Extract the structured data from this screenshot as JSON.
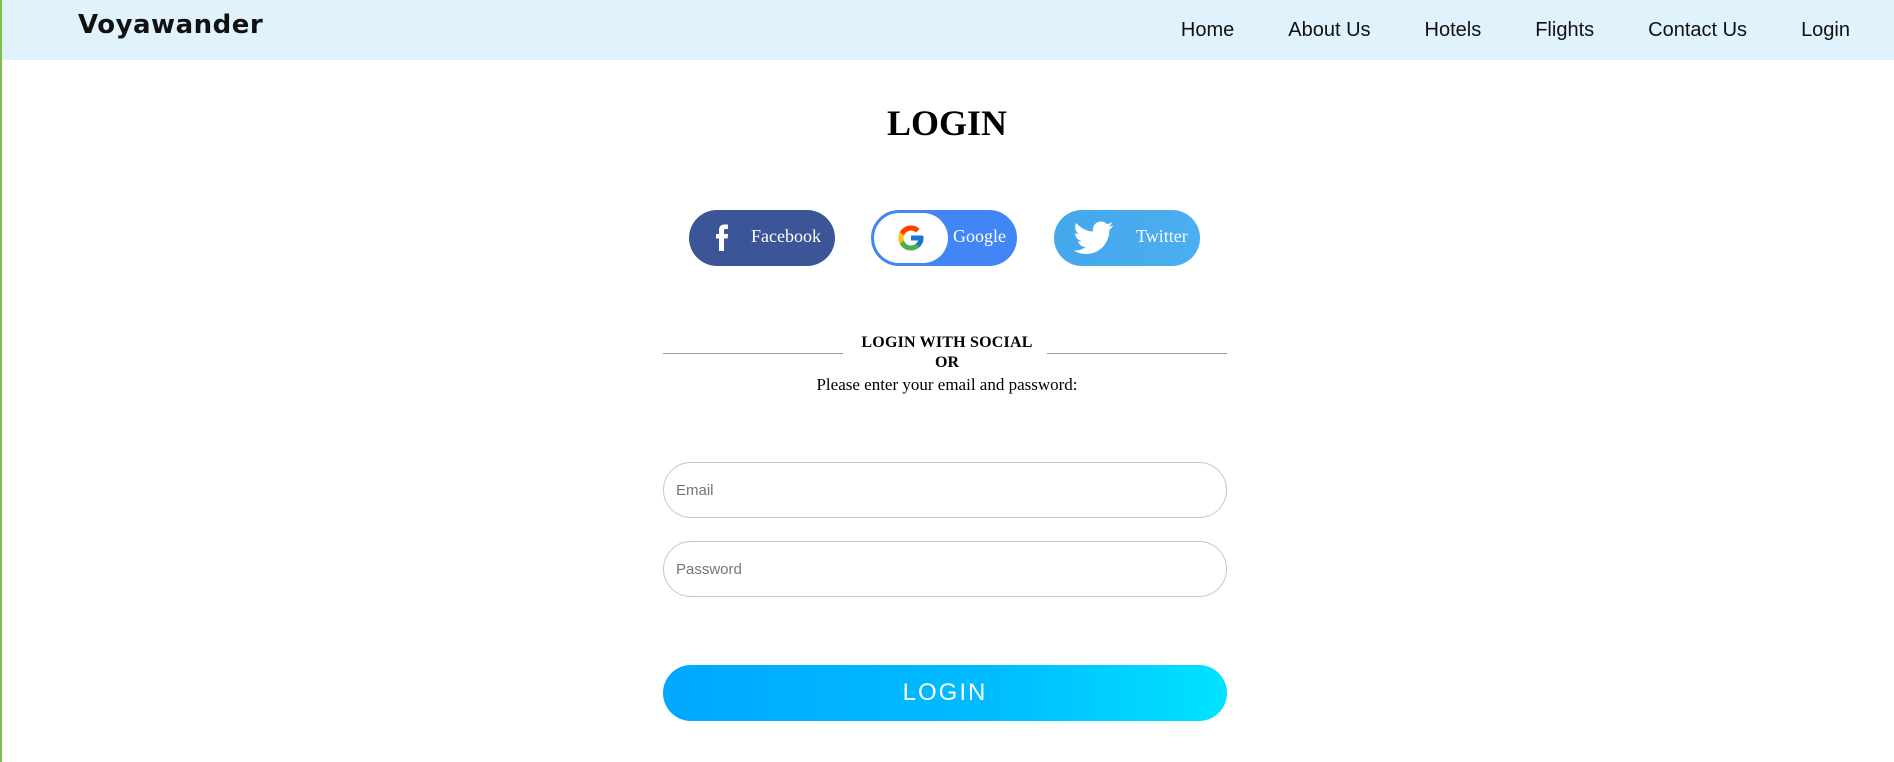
{
  "navbar": {
    "brand": "Voyawander",
    "links": [
      "Home",
      "About Us",
      "Hotels",
      "Flights",
      "Contact Us",
      "Login"
    ]
  },
  "page": {
    "title": "LOGIN"
  },
  "social": {
    "facebook_label": "Facebook",
    "google_label": "Google",
    "twitter_label": "Twitter",
    "caption": "LOGIN WITH SOCIAL",
    "or_text": "OR",
    "instructions": "Please enter your email and password:"
  },
  "form": {
    "email_placeholder": "Email",
    "email_value": "",
    "password_placeholder": "Password",
    "password_value": "",
    "submit_label": "LOGIN"
  },
  "colors": {
    "navbar_bg": "#e0f3fd",
    "facebook": "#3b5596",
    "google": "#4285f4",
    "twitter": "#45a7ec",
    "login_gradient_start": "#00a8ff",
    "login_gradient_end": "#00e3ff"
  },
  "icons": [
    "facebook-icon",
    "google-icon",
    "twitter-icon"
  ]
}
